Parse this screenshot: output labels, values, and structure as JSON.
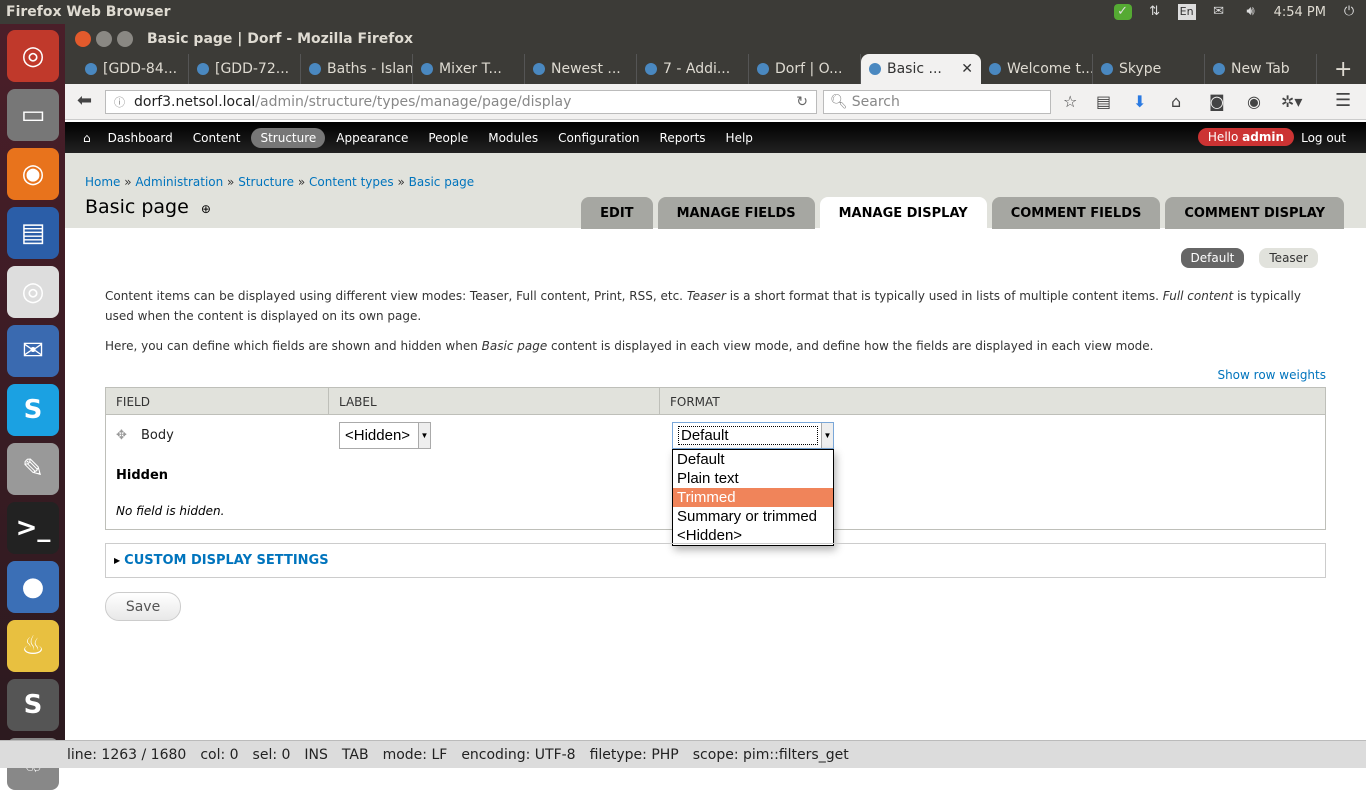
{
  "system": {
    "app_name": "Firefox Web Browser",
    "keyboard": "En",
    "clock": "4:54 PM"
  },
  "launcher": [
    "ubuntu-icon",
    "files-icon",
    "firefox-icon",
    "writer-icon",
    "chrome-icon",
    "thunderbird-icon",
    "skype-icon",
    "text-editor-icon",
    "terminal-icon",
    "bluefish-icon",
    "genie-icon",
    "sublime-icon",
    "trash-icon"
  ],
  "window": {
    "title": "Basic page | Dorf - Mozilla Firefox"
  },
  "tabs": [
    "[GDD-84...",
    "[GDD-72...",
    "Baths - Islan...",
    "Mixer T...",
    "Newest ...",
    "7 - Addi...",
    "Dorf | O...",
    "Basic ...",
    "Welcome t...",
    "Skype",
    "New Tab"
  ],
  "active_tab": 7,
  "nav": {
    "url_host": "dorf3.netsol.local",
    "url_path": "/admin/structure/types/manage/page/display",
    "search_placeholder": "Search"
  },
  "toolbar": {
    "items": [
      "Dashboard",
      "Content",
      "Structure",
      "Appearance",
      "People",
      "Modules",
      "Configuration",
      "Reports",
      "Help"
    ],
    "active": 2,
    "hello": "Hello ",
    "user": "admin",
    "logout": "Log out"
  },
  "breadcrumb": [
    "Home",
    "Administration",
    "Structure",
    "Content types",
    "Basic page"
  ],
  "page_title": "Basic page",
  "page_tabs": [
    "EDIT",
    "MANAGE FIELDS",
    "MANAGE DISPLAY",
    "COMMENT FIELDS",
    "COMMENT DISPLAY"
  ],
  "active_page_tab": 2,
  "view_modes": [
    "Default",
    "Teaser"
  ],
  "desc1": [
    "Content items can be displayed using different view modes: Teaser, Full content, Print, RSS, etc. ",
    "Teaser",
    " is a short format that is typically used in lists of multiple content items. ",
    "Full content",
    " is typically used when the content is displayed on its own page."
  ],
  "desc2": [
    "Here, you can define which fields are shown and hidden when ",
    "Basic page",
    " content is displayed in each view mode, and define how the fields are displayed in each view mode."
  ],
  "show_row_weights": "Show row weights",
  "table": {
    "headers": [
      "Field",
      "Label",
      "Format"
    ],
    "row": {
      "field": "Body",
      "label": "<Hidden>",
      "format": "Default"
    },
    "hidden_heading": "Hidden",
    "hidden_empty": "No field is hidden."
  },
  "format_options": [
    "Default",
    "Plain text",
    "Trimmed",
    "Summary or trimmed",
    "<Hidden>"
  ],
  "highlighted_option": 2,
  "custom_display": "CUSTOM DISPLAY SETTINGS",
  "save": "Save",
  "statusbar": [
    "line: 1263 / 1680",
    "col: 0",
    "sel: 0",
    "INS",
    "TAB",
    "mode: LF",
    "encoding: UTF-8",
    "filetype: PHP",
    "scope: pim::filters_get"
  ],
  "colors": {
    "accent": "#0074bd",
    "highlight": "#f0845a",
    "hello_badge": "#cc3333"
  }
}
